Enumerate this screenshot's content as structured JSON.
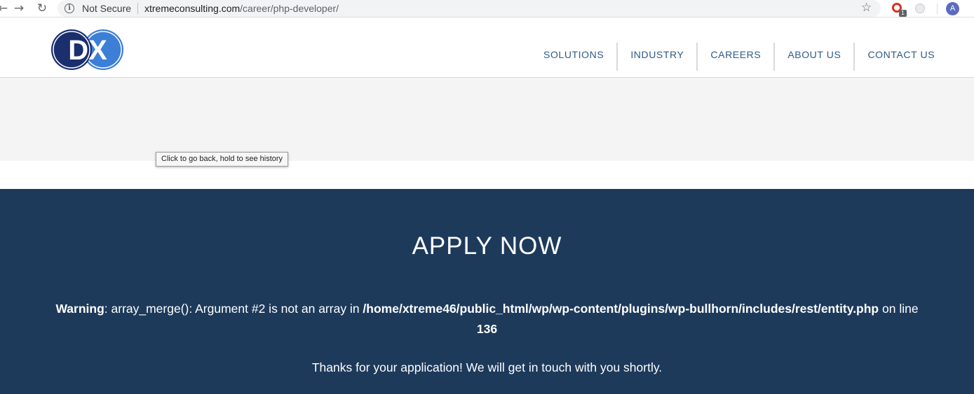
{
  "browser": {
    "security_label": "Not Secure",
    "url_domain": "xtremeconsulting.com",
    "url_path": "/career/php-developer/",
    "extension_badge": "1",
    "profile_initial": "A"
  },
  "header": {
    "logo_text": "DX",
    "nav": [
      {
        "label": "SOLUTIONS"
      },
      {
        "label": "INDUSTRY"
      },
      {
        "label": "CAREERS"
      },
      {
        "label": "ABOUT US"
      },
      {
        "label": "CONTACT US"
      }
    ]
  },
  "tooltip": "Click to go back, hold to see history",
  "apply": {
    "title": "APPLY NOW",
    "warning_label": "Warning",
    "warning_message": ": array_merge(): Argument #2 is not an array in ",
    "warning_path": "/home/xtreme46/public_html/wp/wp-content/plugins/wp-bullhorn/includes/rest/entity.php",
    "warning_online": " on line ",
    "warning_line": "136",
    "thanks": "Thanks for your application! We will get in touch with you shortly."
  },
  "colors": {
    "brand_navy": "#1d3a5b",
    "nav_text": "#2d5b86",
    "logo_dark": "#1b2f6e",
    "logo_light": "#3d7fd6"
  }
}
